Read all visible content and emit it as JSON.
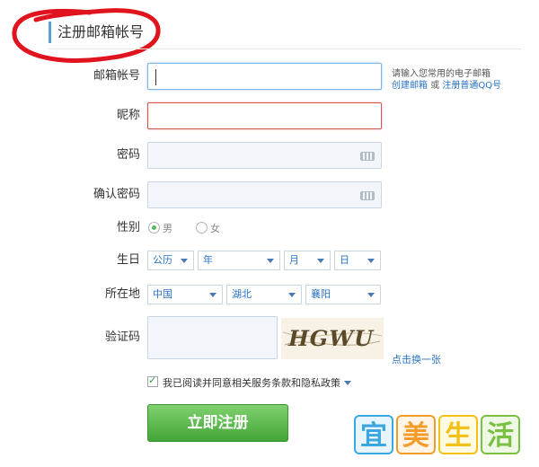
{
  "header": {
    "title": "注册邮箱帐号"
  },
  "form": {
    "email": {
      "label": "邮箱帐号",
      "value": ""
    },
    "email_hint": "请输入您常用的电子邮箱",
    "email_links": {
      "create": "创建邮箱",
      "or": "或",
      "qq": "注册普通QQ号"
    },
    "nickname": {
      "label": "昵称",
      "value": ""
    },
    "password": {
      "label": "密码",
      "value": "",
      "icon": "keyboard-icon"
    },
    "confirm_password": {
      "label": "确认密码",
      "value": "",
      "icon": "keyboard-icon"
    },
    "gender": {
      "label": "性别",
      "options": [
        "男",
        "女"
      ],
      "selected": "男"
    },
    "birthday": {
      "label": "生日",
      "calendar": "公历",
      "year": "年",
      "month": "月",
      "day": "日"
    },
    "location": {
      "label": "所在地",
      "country": "中国",
      "province": "湖北",
      "city": "襄阳"
    },
    "captcha": {
      "label": "验证码",
      "value": "",
      "image_text": "HGWU",
      "refresh": "点击换一张"
    },
    "agree": {
      "checked": true,
      "text": "我已阅读并同意相关服务条款和隐私政策"
    },
    "submit_label": "立即注册"
  },
  "logo": {
    "chars": [
      "宜",
      "美",
      "生",
      "活"
    ],
    "colors": [
      "#3aa7e0",
      "#f39c2a",
      "#f2c21a",
      "#7ac143"
    ]
  },
  "colors": {
    "accent": "#5ba0d9",
    "link": "#2a74c4",
    "error": "#d9534f",
    "submit": "#43a536",
    "annotation": "#e0141e"
  }
}
